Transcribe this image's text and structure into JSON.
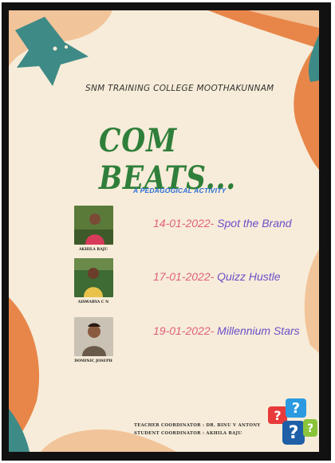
{
  "poster": {
    "college": "SNM TRAINING COLLEGE MOOTHAKUNNAM",
    "title": "COM BEATS...",
    "subtitle": "A PEDAGOGICAL ACTIVITY",
    "events": [
      {
        "date": "14-01-2022-",
        "name": " Spot the Brand",
        "person": "AKHILA RAJU"
      },
      {
        "date": "17-01-2022-",
        "name": " Quizz Hustle",
        "person": "AISWARYA C N"
      },
      {
        "date": "19-01-2022-",
        "name": " Millennium Stars",
        "person": "DOMINIC JOSEPH"
      }
    ],
    "teacher_coordinator": "TEACHER COORDINATOR :  DR. BINU V ANTONY",
    "student_coordinator": "STUDENT COORDINATOR  :  AKHILA RAJU"
  },
  "colors": {
    "title": "#2f7f3a",
    "date": "#e0607a",
    "event_name": "#6a4fc8",
    "subtitle": "#2b6fd6",
    "teal": "#3e8a86",
    "orange": "#e8864a",
    "peach": "#f2c49a"
  },
  "icons": [
    "star-shape",
    "leaf-shape",
    "question-marks-icon"
  ]
}
